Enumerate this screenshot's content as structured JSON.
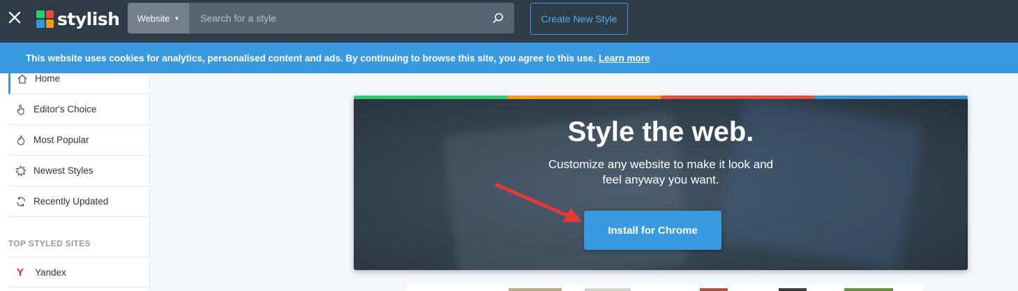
{
  "header": {
    "logo_text": "stylish",
    "logo_colors": [
      "#2ecc71",
      "#e74c3c",
      "#3498db",
      "#f39c12"
    ],
    "search_type": "Website",
    "search_placeholder": "Search for a style",
    "create_button": "Create New Style",
    "bg_color": "#2f3b46"
  },
  "cookie_banner": {
    "text": "This website uses cookies for analytics, personalised content and ads. By continuing to browse this site, you agree to this use.",
    "link": "Learn more",
    "bg_color": "#3a9ae0"
  },
  "sidebar": {
    "items": [
      {
        "label": "Home",
        "icon": "home-icon",
        "active": true
      },
      {
        "label": "Editor's Choice",
        "icon": "pointer-hand-icon"
      },
      {
        "label": "Most Popular",
        "icon": "flame-icon"
      },
      {
        "label": "Newest Styles",
        "icon": "starburst-icon"
      },
      {
        "label": "Recently Updated",
        "icon": "refresh-icon"
      }
    ],
    "section_title": "TOP STYLED SITES",
    "sites": [
      {
        "label": "Yandex",
        "icon": "yandex-icon"
      }
    ]
  },
  "hero": {
    "title": "Style the web.",
    "subtitle_line1": "Customize any website to make it look and",
    "subtitle_line2": "feel anyway you want.",
    "button": "Install for Chrome",
    "stripe_colors": [
      "#2ecc71",
      "#f39c12",
      "#e74c3c",
      "#3498db"
    ],
    "accent_color": "#3a9ae0",
    "annotation_arrow_color": "#e53935"
  }
}
